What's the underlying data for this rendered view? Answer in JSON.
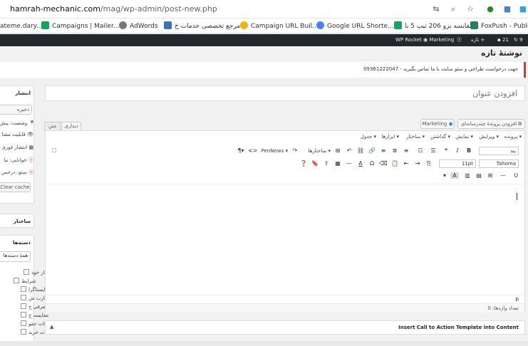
{
  "browser": {
    "url_host": "hamrah-mechanic.com",
    "url_path": "/mag/wp-admin/post-new.php"
  },
  "bookmarks": [
    "ateme.dary...",
    "Campaigns | Mailer...",
    "AdWords",
    "مرجع تخصصی خدمات خ...",
    "Campaign URL Buil...",
    "Google URL Shorte...",
    "مقایسه بزو 206 تیپ 5 با...",
    "FoxPush - Publish"
  ],
  "adminbar": {
    "count": "9",
    "comments": "21",
    "new_label": "تازه",
    "marketing": "Marketing",
    "wp_rocket": "WP Rocket"
  },
  "page_title": "نوشتهٔ تازه",
  "notice": "جهت درخواست طراحی و سئو سایت با ما تماس بگیرید - 09361222047",
  "publish_box": {
    "title": "انتشار",
    "save_draft": "ذخیره پیش‌نویس",
    "status": "وضعیت: پیش",
    "visibility": "قابلیت مشا",
    "publish_time": "انتشار فوری",
    "readability": "خوانایی: نیا",
    "seo": "سئو: درحس",
    "clear_cache": "Clear cache"
  },
  "format_box": {
    "title": "ساختار"
  },
  "categories_box": {
    "title": "دسته‌ها",
    "search_placeholder": "همهٔ دسته‌ها",
    "items": [
      "اخبار خود",
      "شرایط",
      "ایستاگرا",
      "تجارب ش",
      "معرفی خ",
      "مقایسه خ",
      "نکات حقو",
      "نکات خرید"
    ]
  },
  "title_placeholder": "افزودن عنوان",
  "editor": {
    "add_media": "افزودن پروندهٔ چندرسانه‌ای",
    "marketing_button": "Marketing",
    "tab_visual": "دیداری",
    "tab_text": "متن",
    "menus": [
      "پرونده",
      "ویرایش",
      "نمایش",
      "گذاشتن",
      "ساختار",
      "ابزارها",
      "جدول"
    ],
    "font_name": "Tahoma",
    "font_size": "11pt",
    "paragraph": "بند",
    "formats": "ساختارها",
    "pennews": "PenNews",
    "path": "p",
    "word_count": "تعداد واژه‌ها: 0"
  },
  "cta_box": {
    "title": "Insert Call to Action Template into Content"
  }
}
